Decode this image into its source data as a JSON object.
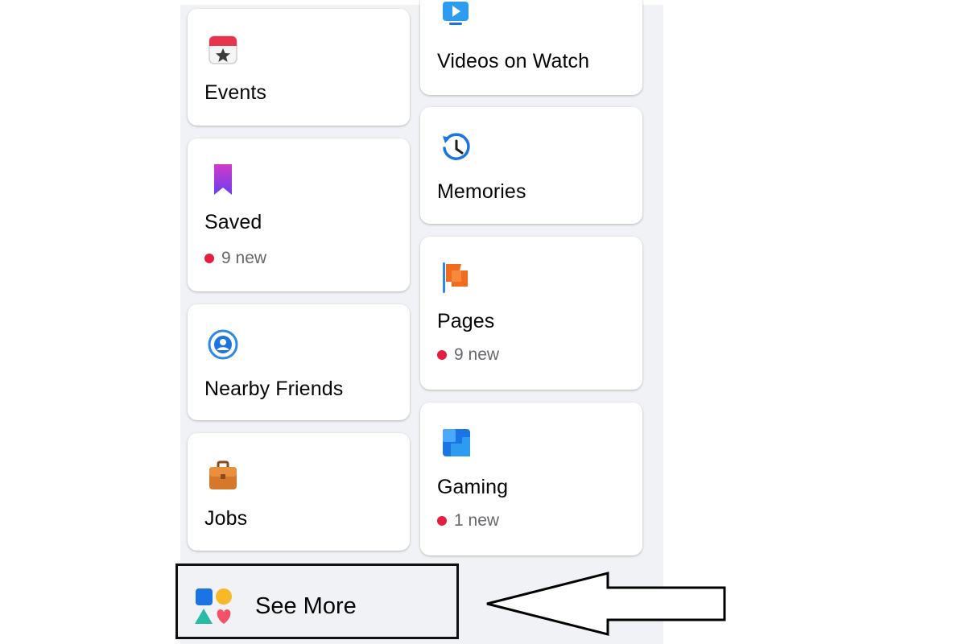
{
  "colors": {
    "panel_bg": "#f0f2f5",
    "card_bg": "#ffffff",
    "badge_dot": "#e41e3f",
    "muted_text": "#65676b"
  },
  "cards": {
    "events": {
      "label": "Events",
      "icon": "calendar-star-icon"
    },
    "videos": {
      "label": "Videos on Watch",
      "icon": "watch-tv-icon"
    },
    "saved": {
      "label": "Saved",
      "badge": "9 new",
      "icon": "bookmark-icon"
    },
    "memories": {
      "label": "Memories",
      "icon": "clock-history-icon"
    },
    "nearby": {
      "label": "Nearby Friends",
      "icon": "location-friends-icon"
    },
    "pages": {
      "label": "Pages",
      "badge": "9 new",
      "icon": "flag-icon"
    },
    "jobs": {
      "label": "Jobs",
      "icon": "briefcase-icon"
    },
    "gaming": {
      "label": "Gaming",
      "badge": "1 new",
      "icon": "gaming-icon"
    }
  },
  "see_more": {
    "label": "See More",
    "icon": "shapes-icon"
  }
}
